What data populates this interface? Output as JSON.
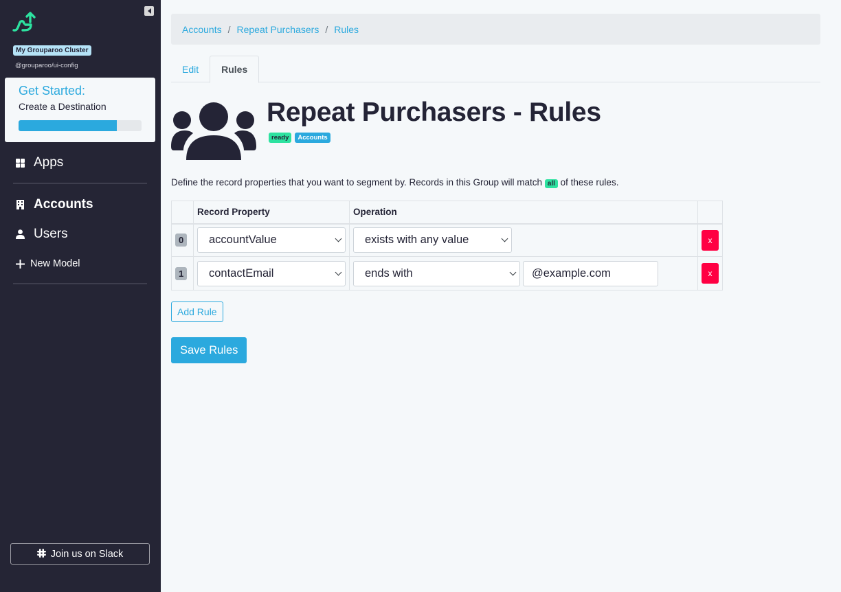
{
  "sidebar": {
    "cluster_name": "My Grouparoo Cluster",
    "cluster_sub": "@grouparoo/ui-config",
    "get_started": {
      "title": "Get Started:",
      "subtitle": "Create a Destination",
      "progress_percent": 80
    },
    "nav": {
      "apps": "Apps",
      "accounts": "Accounts",
      "users": "Users",
      "new_model": "New Model"
    },
    "slack_label": "Join us on Slack"
  },
  "breadcrumb": [
    "Accounts",
    "Repeat Purchasers",
    "Rules"
  ],
  "tabs": {
    "edit": "Edit",
    "rules": "Rules"
  },
  "header": {
    "title": "Repeat Purchasers - Rules",
    "state_badge": "ready",
    "model_badge": "Accounts"
  },
  "description": {
    "before": "Define the record properties that you want to segment by. Records in this Group will match ",
    "match": "all",
    "after": " of these rules."
  },
  "table": {
    "headers": {
      "index": "",
      "property": "Record Property",
      "operation": "Operation",
      "delete": ""
    },
    "rows": [
      {
        "index": "0",
        "property": "accountValue",
        "operation": "exists with any value",
        "value": null,
        "delete_label": "x"
      },
      {
        "index": "1",
        "property": "contactEmail",
        "operation": "ends with",
        "value": "@example.com",
        "delete_label": "x"
      }
    ]
  },
  "buttons": {
    "add_rule": "Add Rule",
    "save_rules": "Save Rules"
  },
  "colors": {
    "accent": "#2ba9de",
    "success": "#2de2a0",
    "danger": "#ff0043",
    "sidebar": "#252535"
  }
}
